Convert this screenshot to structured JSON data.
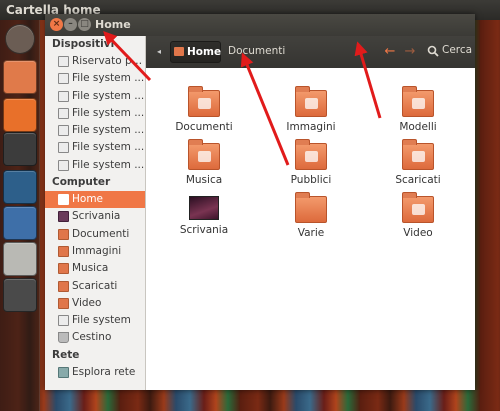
{
  "topbar": {
    "title": "Cartella home"
  },
  "window": {
    "title": "Home",
    "close": "×",
    "minimize": "–",
    "maximize": "□"
  },
  "launcher": [
    {
      "name": "ubuntu-dash",
      "color": "#6b5d54"
    },
    {
      "name": "home-folder",
      "color": "#e07a4a"
    },
    {
      "name": "firefox",
      "color": "#e8702a"
    },
    {
      "name": "terminal",
      "color": "#3c3c3c"
    },
    {
      "name": "image-viewer",
      "color": "#2d5f8a"
    },
    {
      "name": "thunderbird",
      "color": "#3e6fa8"
    },
    {
      "name": "text-editor",
      "color": "#b9b9b4"
    },
    {
      "name": "workspace-switcher",
      "color": "#4a4a4a"
    }
  ],
  "sidebar": {
    "sections": [
      {
        "title": "Dispositivi",
        "items": [
          {
            "label": "Riservato pe...",
            "icon": "drive-icon"
          },
          {
            "label": "File system ...",
            "icon": "drive-icon"
          },
          {
            "label": "File system ...",
            "icon": "drive-icon"
          },
          {
            "label": "File system ...",
            "icon": "drive-icon"
          },
          {
            "label": "File system ...",
            "icon": "drive-icon"
          },
          {
            "label": "File system ...",
            "icon": "drive-icon"
          },
          {
            "label": "File system ...",
            "icon": "drive-icon"
          }
        ]
      },
      {
        "title": "Computer",
        "items": [
          {
            "label": "Home",
            "icon": "home-folder-icon",
            "selected": true
          },
          {
            "label": "Scrivania",
            "icon": "desktop-icon"
          },
          {
            "label": "Documenti",
            "icon": "folder-icon"
          },
          {
            "label": "Immagini",
            "icon": "folder-icon"
          },
          {
            "label": "Musica",
            "icon": "folder-icon"
          },
          {
            "label": "Scaricati",
            "icon": "folder-icon"
          },
          {
            "label": "Video",
            "icon": "folder-icon"
          },
          {
            "label": "File system",
            "icon": "drive-icon"
          },
          {
            "label": "Cestino",
            "icon": "trash-icon"
          }
        ]
      },
      {
        "title": "Rete",
        "items": [
          {
            "label": "Esplora rete",
            "icon": "network-icon"
          }
        ]
      }
    ]
  },
  "toolbar": {
    "back_glyph": "◂",
    "home_crumb": "Home",
    "documents_crumb": "Documenti",
    "back_arrow": "←",
    "forward_arrow": "→",
    "search_label": "Cerca"
  },
  "files": [
    {
      "label": "Documenti",
      "icon": "documents-folder-icon",
      "emblem": true
    },
    {
      "label": "Immagini",
      "icon": "pictures-folder-icon",
      "emblem": true
    },
    {
      "label": "Modelli",
      "icon": "templates-folder-icon",
      "emblem": true
    },
    {
      "label": "Musica",
      "icon": "music-folder-icon",
      "emblem": true
    },
    {
      "label": "Pubblici",
      "icon": "public-folder-icon",
      "emblem": true
    },
    {
      "label": "Scaricati",
      "icon": "downloads-folder-icon",
      "emblem": true
    },
    {
      "label": "Scrivania",
      "icon": "desktop-folder-icon",
      "emblem": false
    },
    {
      "label": "Varie",
      "icon": "folder-icon",
      "emblem": false
    },
    {
      "label": "Video",
      "icon": "videos-folder-icon",
      "emblem": true
    }
  ],
  "colors": {
    "accent": "#f07746",
    "annotation": "#e11b1b"
  }
}
